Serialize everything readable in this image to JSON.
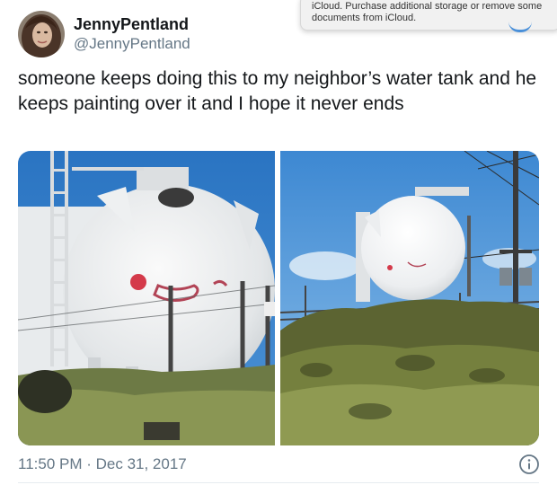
{
  "user": {
    "display_name": "JennyPentland",
    "handle": "@JennyPentland"
  },
  "notification": {
    "text": "iCloud. Purchase additional storage or remove some documents from iCloud."
  },
  "tweet": {
    "text": "someone keeps doing this to my neighbor’s water tank and he keeps painting over it and I hope it never ends",
    "timestamp": "11:50 PM · Dec 31, 2017"
  },
  "icons": {
    "info": "info-icon"
  }
}
